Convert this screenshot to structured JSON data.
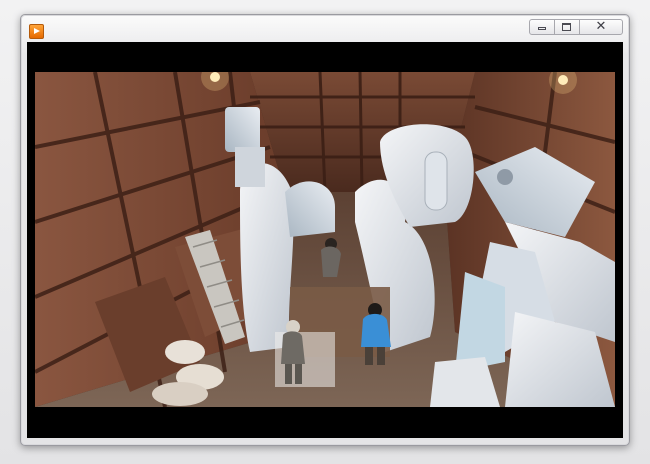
{
  "window": {
    "title": "",
    "icon": "media-player-icon",
    "controls": {
      "minimize": "minimize-icon",
      "maximize": "maximize-icon",
      "close_glyph": "✕"
    }
  },
  "video": {
    "content": "video-frame"
  },
  "colors": {
    "wood": "#6b3c28",
    "foam": "#e8e9ec",
    "jacket": "#3a8fd6",
    "letterbox": "#000000"
  }
}
